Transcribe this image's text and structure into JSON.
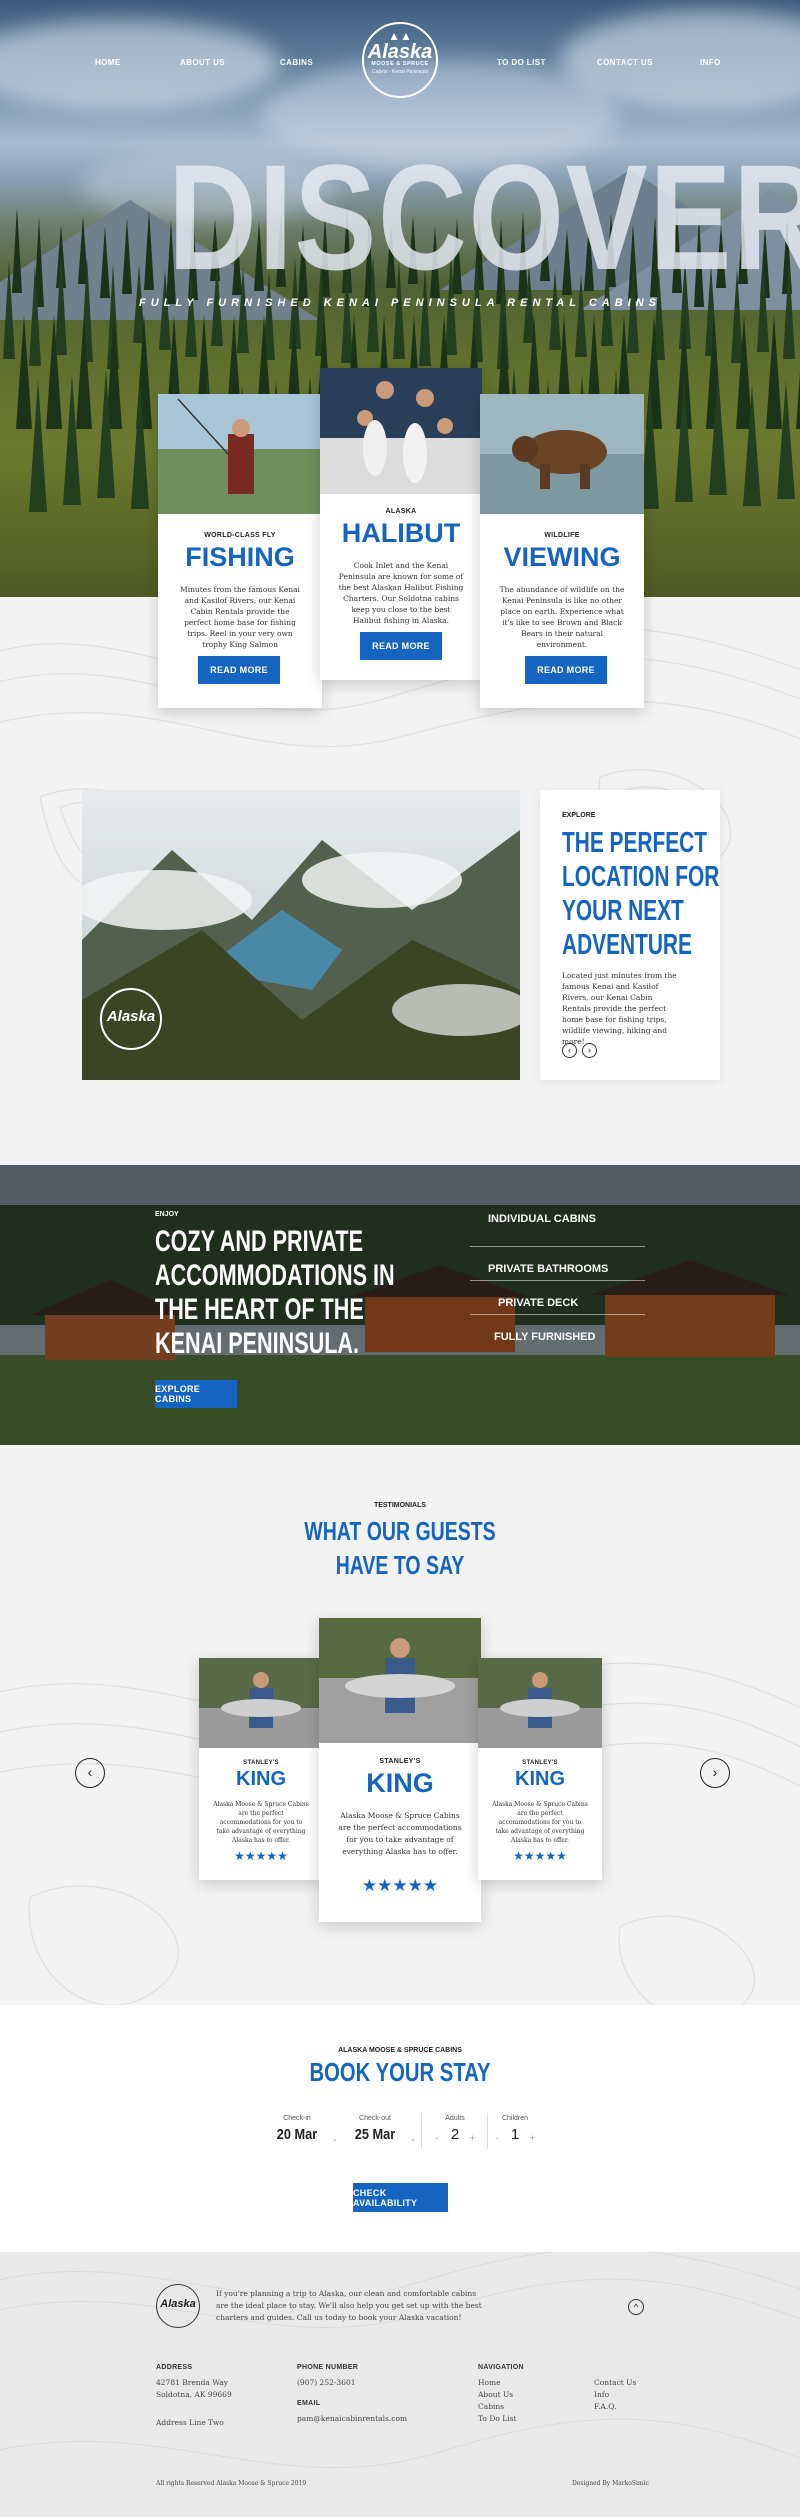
{
  "nav": {
    "left": [
      "HOME",
      "ABOUT US",
      "CABINS"
    ],
    "right": [
      "TO DO LIST",
      "CONTACT US",
      "INFO"
    ]
  },
  "logo": {
    "name": "Alaska",
    "sub": "MOOSE & SPRUCE",
    "tag": "Cabins · Kenai Peninsula"
  },
  "hero": {
    "title": "DISCOVER",
    "subtitle": "FULLY FURNISHED KENAI PENINSULA RENTAL CABINS"
  },
  "activities": [
    {
      "kicker": "WORLD-CLASS FLY",
      "title": "FISHING",
      "body": "Minutes from the famous Kenai and Kasilof Rivers, our Kenai Cabin Rentals provide the perfect home base for fishing trips. Reel in your very own trophy King Salmon",
      "button": "READ MORE"
    },
    {
      "kicker": "ALASKA",
      "title": "HALIBUT",
      "body": "Cook Inlet and the Kenai Peninsula are known for some of the best Alaskan Halibut Fishing Charters. Our Soldotna cabins keep you close to the best Halibut fishing in Alaska.",
      "button": "READ MORE"
    },
    {
      "kicker": "WILDLIFE",
      "title": "VIEWING",
      "body": "The abundance of wildlife on the Kenai Peninsula is like no other place on earth. Experience what it's like to see Brown and Black Bears in their natural environment.",
      "button": "READ MORE"
    }
  ],
  "explore": {
    "kicker": "EXPLORE",
    "title_lines": [
      "THE PERFECT",
      "LOCATION FOR",
      "YOUR NEXT",
      "ADVENTURE"
    ],
    "body": "Located just minutes from the famous Kenai and Kasilof Rivers, our Kenai Cabin Rentals provide the perfect home base for fishing trips, wildlife viewing, hiking and more!"
  },
  "enjoy": {
    "kicker": "ENJOY",
    "title_lines": [
      "COZY AND PRIVATE",
      "ACCOMMODATIONS IN",
      "THE HEART OF THE",
      "KENAI PENINSULA."
    ],
    "button": "EXPLORE CABINS",
    "features": [
      "INDIVIDUAL CABINS",
      "PRIVATE BATHROOMS",
      "PRIVATE DECK",
      "FULLY FURNISHED"
    ]
  },
  "testimonials": {
    "kicker": "TESTIMONIALS",
    "title_lines": [
      "WHAT OUR GUESTS",
      "HAVE TO SAY"
    ],
    "items": [
      {
        "kicker": "STANLEY'S",
        "name": "KING",
        "quote": "Alaska Moose & Spruce Cabins are the perfect accommodations for you to take advantage of everything Alaska has to offer.",
        "stars": "★★★★★"
      },
      {
        "kicker": "STANLEY'S",
        "name": "KING",
        "quote": "Alaska Moose & Spruce Cabins are the perfect accommodations for you to take advantage of everything Alaska has to offer.",
        "stars": "★★★★★"
      },
      {
        "kicker": "STANLEY'S",
        "name": "KING",
        "quote": "Alaska Moose & Spruce Cabins are the perfect accommodations for you to take advantage of everything Alaska has to offer.",
        "stars": "★★★★★"
      }
    ]
  },
  "booking": {
    "kicker": "ALASKA MOOSE & SPRUCE CABINS",
    "title": "BOOK YOUR STAY",
    "checkin_label": "Check-in",
    "checkin": "20 Mar",
    "checkout_label": "Check-out",
    "checkout": "25 Mar",
    "adults_label": "Adults",
    "adults": "2",
    "children_label": "Children",
    "children": "1",
    "button": "CHECK AVAILABILITY"
  },
  "footer": {
    "intro": "If you're planning a trip to Alaska, our clean and comfortable cabins are the ideal place to stay. We'll also help you get set up with the best charters and guides. Call us today to book your Alaska vacation!",
    "address_label": "ADDRESS",
    "address": [
      "42781 Brenda Way",
      "Soldotna, AK 99669",
      "Address Line Two"
    ],
    "phone_label": "PHONE NUMBER",
    "phone": "(907) 252-3601",
    "email_label": "EMAIL",
    "email": "pam@kenaicabinrentals.com",
    "nav_label": "NAVIGATION",
    "nav_col1": [
      "Home",
      "About Us",
      "Cabins",
      "To Do List"
    ],
    "nav_col2": [
      "Contact Us",
      "Info",
      "F.A.Q."
    ],
    "copyright": "All rights Reserved Alaska Moose & Spruce 2019",
    "credit": "Designed By MarkoSimic"
  },
  "colors": {
    "accent": "#1565c0",
    "footer_bg": "#e9e9e9"
  }
}
